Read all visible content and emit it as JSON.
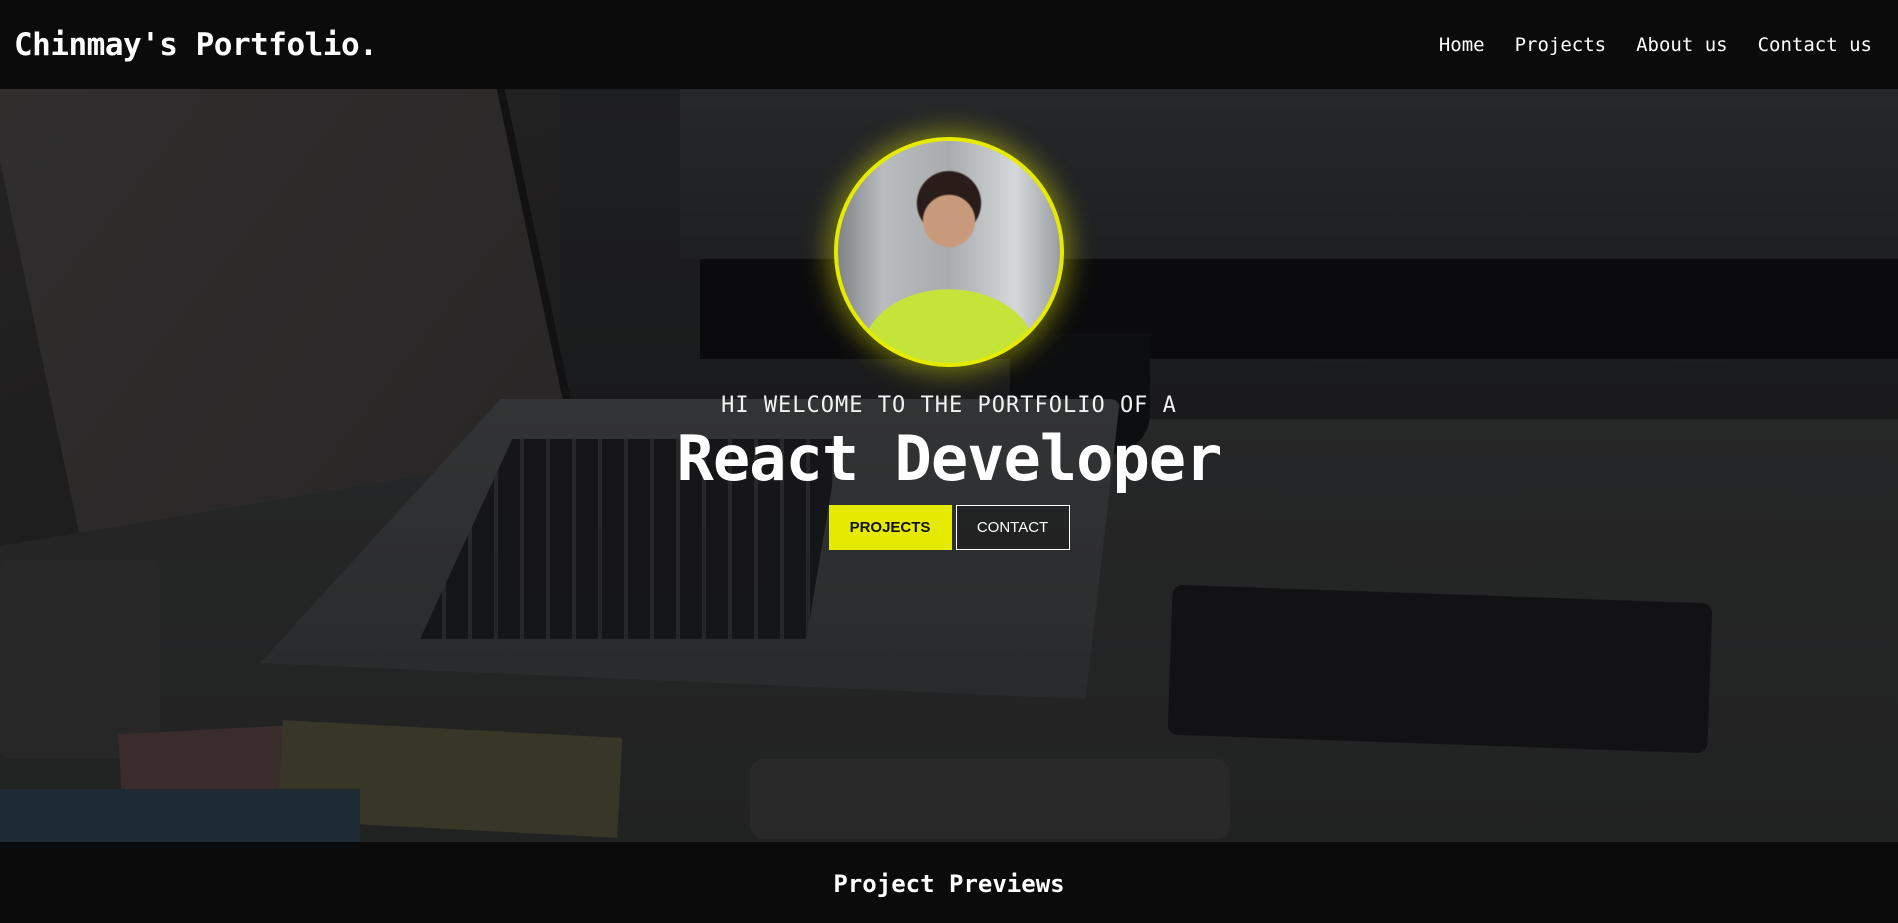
{
  "navbar": {
    "brand": "Chinmay's Portfolio.",
    "links": [
      "Home",
      "Projects",
      "About us",
      "Contact us"
    ]
  },
  "hero": {
    "avatar_alt": "profile-photo",
    "welcome_text": "HI WELCOME TO THE PORTFOLIO OF A",
    "role_text": "React Developer",
    "buttons": {
      "projects_label": "PROJECTS",
      "contact_label": "CONTACT"
    }
  },
  "previews": {
    "title": "Project Previews"
  },
  "colors": {
    "accent": "#e6ea00",
    "background": "#0b0b0b",
    "text": "#ffffff"
  }
}
